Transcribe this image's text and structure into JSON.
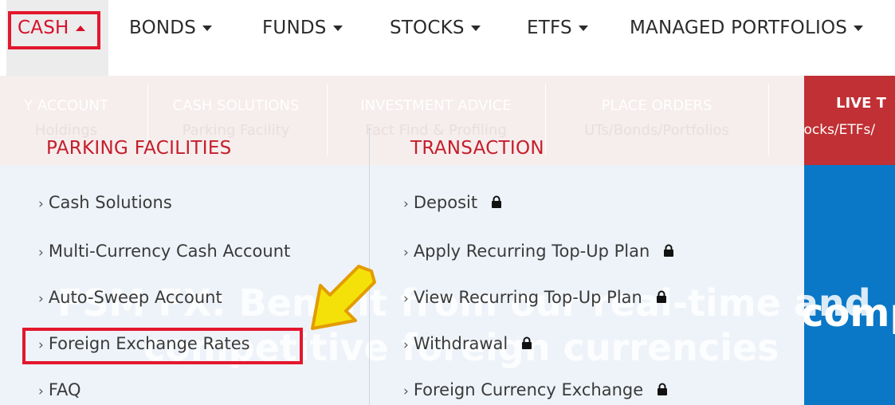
{
  "nav": {
    "items": [
      {
        "label": "CASH",
        "active": true
      },
      {
        "label": "BONDS"
      },
      {
        "label": "FUNDS"
      },
      {
        "label": "STOCKS"
      },
      {
        "label": "ETFS"
      },
      {
        "label": "MANAGED PORTFOLIOS"
      }
    ]
  },
  "subnav": {
    "cols": [
      {
        "line1": "Y ACCOUNT",
        "line2": "Holdings"
      },
      {
        "line1": "CASH SOLUTIONS",
        "line2": "Parking Facility"
      },
      {
        "line1": "INVESTMENT ADVICE",
        "line2": "Fact Find & Profiling"
      },
      {
        "line1": "PLACE ORDERS",
        "line2": "UTs/Bonds/Portfolios"
      }
    ],
    "live": {
      "line1": "LIVE T",
      "line2": "Stocks/ETFs/"
    }
  },
  "hero": {
    "line1": "FSM FX: Benefit from our real-time and",
    "line2": "competitive foreign currencies",
    "right_text": "compe"
  },
  "menu": {
    "parking": {
      "title": "PARKING FACILITIES",
      "items": [
        "Cash Solutions",
        "Multi-Currency Cash Account",
        "Auto-Sweep Account",
        "Foreign Exchange Rates",
        "FAQ"
      ]
    },
    "transaction": {
      "title": "TRANSACTION",
      "items": [
        "Deposit",
        "Apply Recurring Top-Up Plan",
        "View Recurring Top-Up Plan",
        "Withdrawal",
        "Foreign Currency Exchange"
      ]
    }
  },
  "chevron": "›",
  "colors": {
    "brand_red": "#d6102b",
    "highlight": "#e3172d",
    "arrow_fill": "#f5e10a",
    "arrow_stroke": "#e39c00",
    "hero_blue": "#0a78c7"
  },
  "icons": {
    "lock": "lock-icon",
    "caret": "caret-icon",
    "arrow": "arrow-annotation"
  }
}
